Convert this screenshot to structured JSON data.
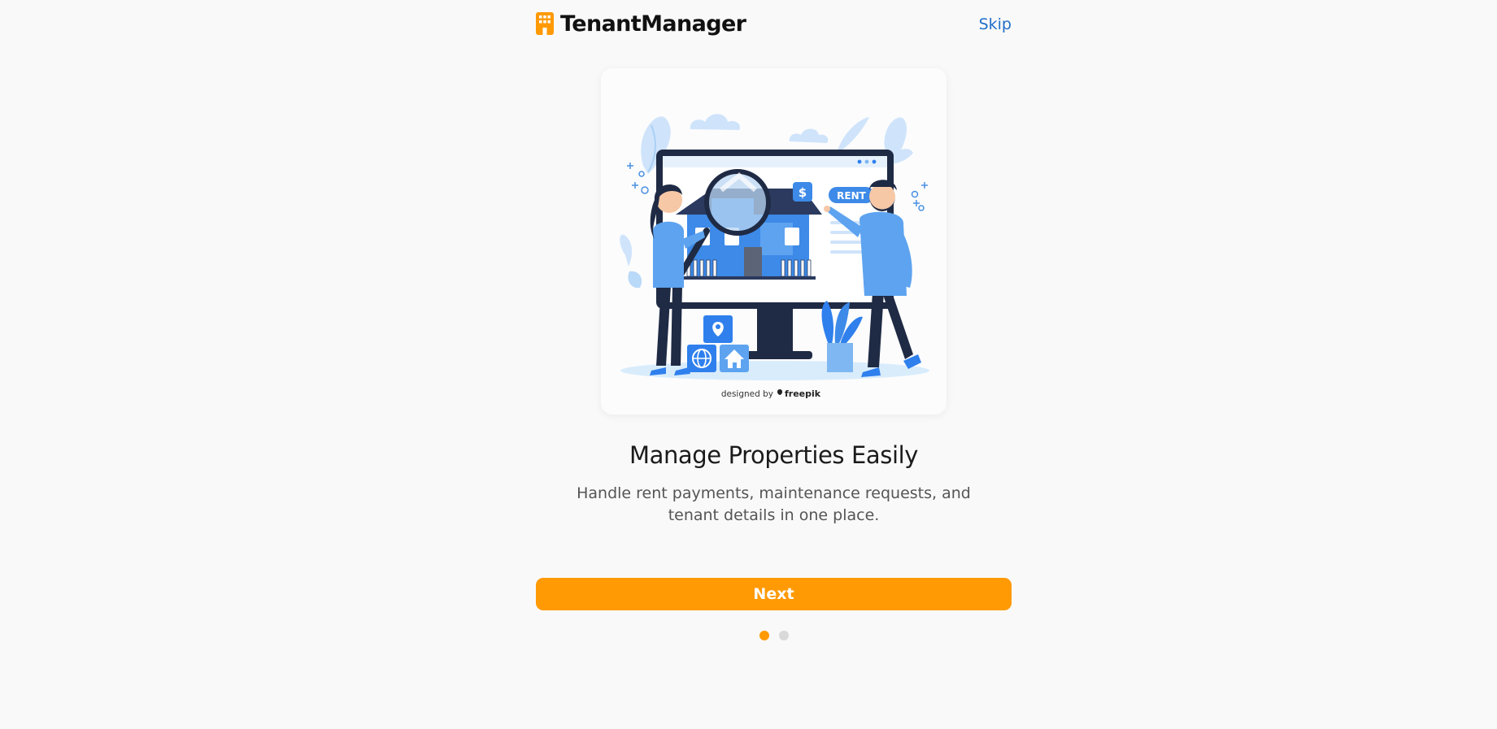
{
  "header": {
    "app_name": "TenantManager",
    "logo_icon": "building-icon",
    "skip_label": "Skip"
  },
  "illustration": {
    "rent_tag": "RENT",
    "price_symbol": "$",
    "credit_prefix": "designed by",
    "credit_brand": "freepik"
  },
  "slide": {
    "title": "Manage Properties Easily",
    "description": "Handle rent payments, maintenance requests, and tenant details in one place."
  },
  "actions": {
    "next_label": "Next"
  },
  "pagination": {
    "total": 2,
    "current": 1
  },
  "colors": {
    "accent": "#ff9a05",
    "link": "#1f6fc9",
    "dot_active": "#ff9a05",
    "dot_inactive": "#d9d9d9"
  }
}
